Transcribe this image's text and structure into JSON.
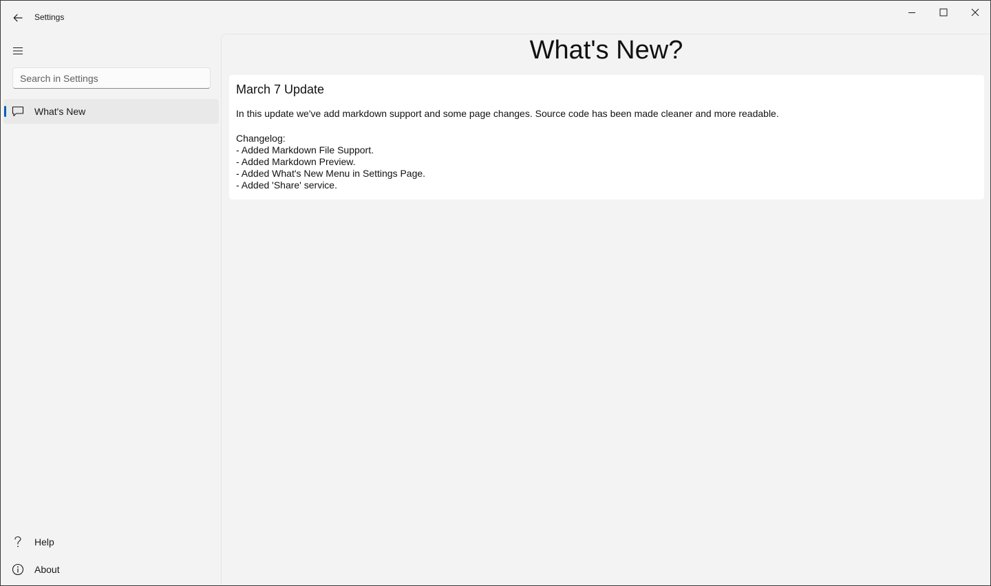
{
  "window": {
    "title": "Settings"
  },
  "sidebar": {
    "search_placeholder": "Search in Settings",
    "items": [
      {
        "label": "What's New",
        "icon": "comment-icon",
        "selected": true
      }
    ],
    "footer_items": [
      {
        "label": "Help",
        "icon": "question-icon"
      },
      {
        "label": "About",
        "icon": "info-icon"
      }
    ]
  },
  "main": {
    "page_title": "What's New?",
    "update": {
      "title": "March 7 Update",
      "intro": "In this update we've add markdown support and some page changes. Source code has been made cleaner and more readable.",
      "changelog_heading": "Changelog:",
      "changelog": [
        "- Added Markdown File Support.",
        "- Added Markdown Preview.",
        "- Added What's New Menu in Settings Page.",
        "- Added 'Share' service."
      ]
    }
  },
  "colors": {
    "accent": "#005fb8",
    "background": "#f3f3f3",
    "card": "#ffffff"
  }
}
